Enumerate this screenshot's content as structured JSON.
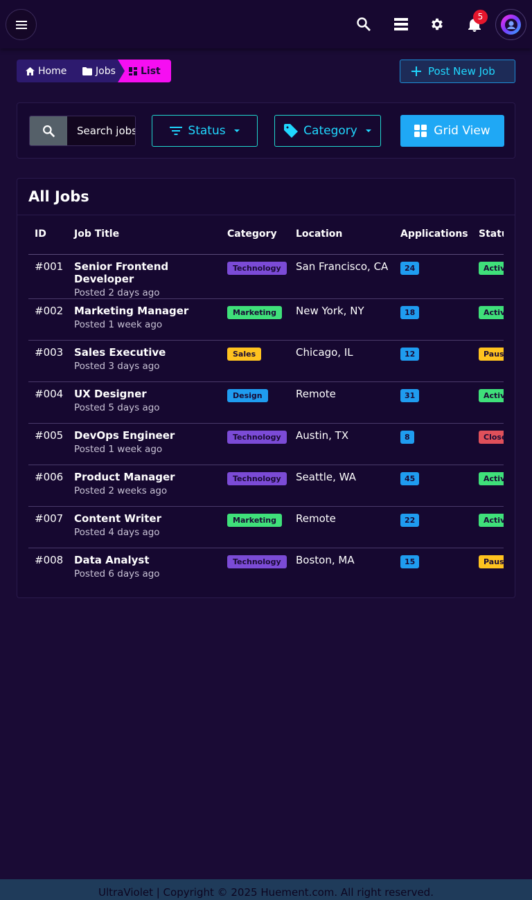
{
  "topbar": {
    "notification_count": "5",
    "icons": [
      "menu-icon",
      "search-icon",
      "layers-icon",
      "gear-icon",
      "bell-icon",
      "user-icon"
    ]
  },
  "breadcrumb": {
    "home": "Home",
    "jobs": "Jobs",
    "list": "List"
  },
  "actions": {
    "post_new_job": "Post New Job"
  },
  "filters": {
    "search_placeholder": "Search jobs...",
    "status_label": "Status",
    "category_label": "Category",
    "grid_view_label": "Grid View"
  },
  "jobs": {
    "title": "All Jobs",
    "columns": [
      "ID",
      "Job Title",
      "Category",
      "Location",
      "Applications",
      "Status"
    ],
    "rows": [
      {
        "id": "#001",
        "title": "Senior Frontend Developer",
        "posted": "Posted 2 days ago",
        "category": "Technology",
        "category_color": "#7b4bd6",
        "location": "San Francisco, CA",
        "applications": "24",
        "status": "Active",
        "status_color": "#3fe07a"
      },
      {
        "id": "#002",
        "title": "Marketing Manager",
        "posted": "Posted 1 week ago",
        "category": "Marketing",
        "category_color": "#3fe07a",
        "location": "New York, NY",
        "applications": "18",
        "status": "Active",
        "status_color": "#3fe07a"
      },
      {
        "id": "#003",
        "title": "Sales Executive",
        "posted": "Posted 3 days ago",
        "category": "Sales",
        "category_color": "#ffc21f",
        "location": "Chicago, IL",
        "applications": "12",
        "status": "Paused",
        "status_color": "#ffc21f"
      },
      {
        "id": "#004",
        "title": "UX Designer",
        "posted": "Posted 5 days ago",
        "category": "Design",
        "category_color": "#1f9cf0",
        "location": "Remote",
        "applications": "31",
        "status": "Active",
        "status_color": "#3fe07a"
      },
      {
        "id": "#005",
        "title": "DevOps Engineer",
        "posted": "Posted 1 week ago",
        "category": "Technology",
        "category_color": "#7b4bd6",
        "location": "Austin, TX",
        "applications": "8",
        "status": "Closed",
        "status_color": "#e0505a"
      },
      {
        "id": "#006",
        "title": "Product Manager",
        "posted": "Posted 2 weeks ago",
        "category": "Technology",
        "category_color": "#7b4bd6",
        "location": "Seattle, WA",
        "applications": "45",
        "status": "Active",
        "status_color": "#3fe07a"
      },
      {
        "id": "#007",
        "title": "Content Writer",
        "posted": "Posted 4 days ago",
        "category": "Marketing",
        "category_color": "#3fe07a",
        "location": "Remote",
        "applications": "22",
        "status": "Active",
        "status_color": "#3fe07a"
      },
      {
        "id": "#008",
        "title": "Data Analyst",
        "posted": "Posted 6 days ago",
        "category": "Technology",
        "category_color": "#7b4bd6",
        "location": "Boston, MA",
        "applications": "15",
        "status": "Paused",
        "status_color": "#ffc21f"
      }
    ]
  },
  "footer": {
    "text": "UltraViolet | Copyright © 2025 Huement.com. All right reserved."
  }
}
